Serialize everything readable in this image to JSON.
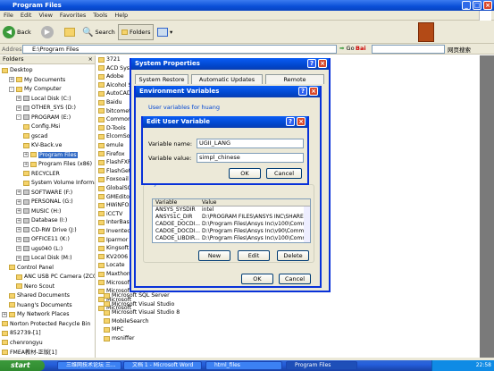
{
  "window": {
    "title": "Program Files"
  },
  "menu": [
    "File",
    "Edit",
    "View",
    "Favorites",
    "Tools",
    "Help"
  ],
  "toolbar": {
    "back": "Back",
    "search": "Search",
    "folders": "Folders",
    "go": "Go",
    "web_page": "网页搜索"
  },
  "address": {
    "label": "Address",
    "value": "E:\\Program Files"
  },
  "folders_pane": {
    "title": "Folders",
    "items": [
      "Desktop",
      "My Documents",
      "My Computer",
      "Local Disk (C:)",
      "OTHER_SYS (D:)",
      "PROGRAM (E:)",
      "Config.Msi",
      "gscad",
      "KV-Back.ve",
      "Program Files",
      "Program Files (x86)",
      "RECYCLER",
      "System Volume Informat",
      "SOFTWARE (F:)",
      "PERSONAL (G:)",
      "MUSIC (H:)",
      "Database (I:)",
      "CD-RW Drive (J:)",
      "OFFICE11 (K:)",
      "ugs040 (L:)",
      "Local Disk (M:)",
      "Control Panel",
      "ANC USB PC Camera (ZC030",
      "Nero Scout",
      "Shared Documents",
      "huang's Documents",
      "My Network Places",
      "Norton Protected Recycle Bin",
      "852739-[1]",
      "chenrongyu",
      "FMEA教材-正版[1]"
    ]
  },
  "file_list": {
    "col1": [
      "3721",
      "ACD Syste",
      "Adobe",
      "Alcohol So",
      "AutoCAD 2",
      "Baidu",
      "bitcomet",
      "Common F",
      "D-Tools",
      "ElcomSoft",
      "emule",
      "Firefox",
      "FlashFXP",
      "FlashGet",
      "Foxsoail",
      "GlobalSCA",
      "GMEditor",
      "HWiNFO32",
      "iCCTV",
      "InterBase",
      "Inventec",
      "Iparmor",
      "Kingsoft",
      "KV2006",
      "Locate",
      "Maxthon",
      "Microsoft",
      "Microsoft",
      "Microsoft",
      "Microsoft"
    ],
    "col1b": [
      "Microsoft SQL Server",
      "Microsoft Visual Studio",
      "Microsoft Visual Studio 8",
      "MobileSearch",
      "MPC",
      "msniffer"
    ]
  },
  "system_properties": {
    "title": "System Properties",
    "tabs": [
      "System Restore",
      "Automatic Updates",
      "Remote"
    ]
  },
  "env_vars": {
    "title": "Environment Variables",
    "user_group": "User variables for huang",
    "system_group": "System variables",
    "col_variable": "Variable",
    "col_value": "Value",
    "rows": [
      {
        "name": "ANSYS_SYSDIR",
        "value": "intel"
      },
      {
        "name": "ANSYS1C_DIR",
        "value": "D:\\PROGRAM FILES\\ANSYS INC\\SHARE..."
      },
      {
        "name": "CADOE_DOCDI...",
        "value": "D:\\Program Files\\Ansys Inc\\v100\\Comm..."
      },
      {
        "name": "CADOE_DOCDI...",
        "value": "D:\\Program Files\\Ansys Inc\\v90\\Comm..."
      },
      {
        "name": "CADOE_LIBDIR...",
        "value": "D:\\Program Files\\Ansys Inc\\v100\\Comm..."
      }
    ],
    "buttons": {
      "new": "New",
      "edit": "Edit",
      "delete": "Delete",
      "ok": "OK",
      "cancel": "Cancel"
    }
  },
  "edit_var": {
    "title": "Edit User Variable",
    "name_label": "Variable name:",
    "name_value": "UGII_LANG",
    "value_label": "Variable value:",
    "value_value": "simpl_chinese",
    "ok": "OK",
    "cancel": "Cancel"
  },
  "taskbar": {
    "start": "start",
    "items": [
      "三维网技术论坛 三...",
      "文档 1 - Microsoft Word",
      "html_files",
      "Program Files"
    ],
    "clock": "22:58"
  }
}
